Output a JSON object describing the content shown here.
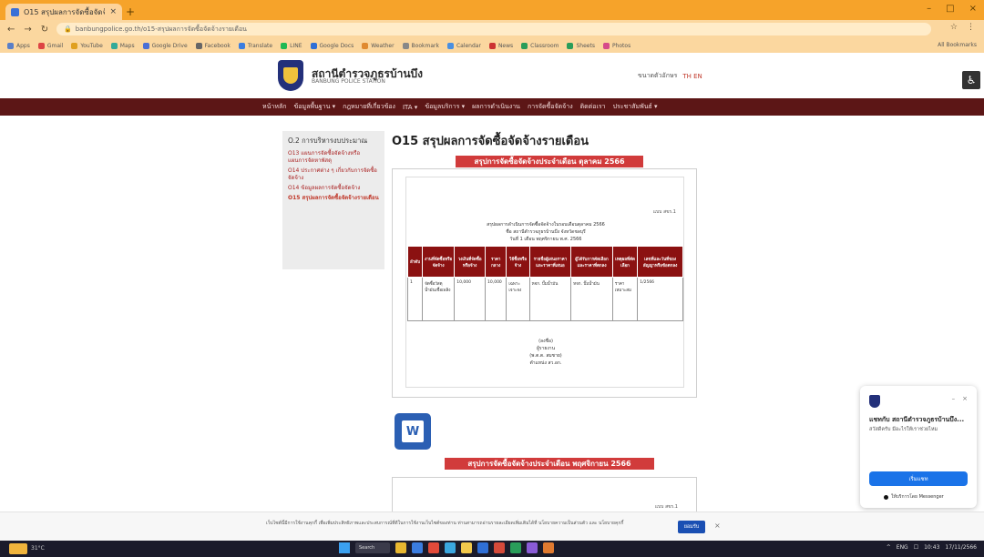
{
  "browser": {
    "tab_title": "O15 สรุปผลการจัดซื้อจัดจ้าง...",
    "tab_close": "×",
    "new_tab": "+",
    "window_controls": [
      "–",
      "□",
      "×"
    ],
    "nav": [
      "←",
      "→",
      "↻"
    ],
    "url": "banbungpolice.go.th/o15-สรุปผลการจัดซื้อจัดจ้างรายเดือน",
    "right_icons": [
      "☆",
      "⋮"
    ],
    "bookmarks": [
      "Apps",
      "Gmail",
      "YouTube",
      "Maps",
      "Google Drive",
      "Facebook",
      "Translate",
      "LINE",
      "Google Docs",
      "Weather",
      "Bookmark",
      "Calendar",
      "News",
      "Classroom",
      "Sheets",
      "Photos"
    ],
    "bookmarks_right": "All Bookmarks"
  },
  "site": {
    "name": "สถานีตำรวจภูธรบ้านบึง",
    "subtitle": "BANBUNG POLICE STATION",
    "header_right": "ขนาดตัวอักษร",
    "lang": "TH EN",
    "accessibility_icon": "♿"
  },
  "nav": {
    "items": [
      "หน้าหลัก",
      "ข้อมูลพื้นฐาน ▾",
      "กฎหมายที่เกี่ยวข้อง",
      "ITA ▾",
      "ข้อมูลบริการ ▾",
      "ผลการดำเนินงาน",
      "การจัดซื้อจัดจ้าง",
      "ติดต่อเรา",
      "ประชาสัมพันธ์ ▾"
    ]
  },
  "sidebar": {
    "title": "O.2 การบริหารงบประมาณ",
    "items": [
      "O13 แผนการจัดซื้อจัดจ้างหรือแผนการจัดหาพัสดุ",
      "O14 ประกาศต่าง ๆ เกี่ยวกับการจัดซื้อจัดจ้าง",
      "O14 ข้อมูลผลการจัดซื้อจัดจ้าง",
      "O15 สรุปผลการจัดซื้อจัดจ้างรายเดือน"
    ]
  },
  "main": {
    "title": "O15 สรุปผลการจัดซื้อจัดจ้างรายเดือน",
    "label1": "สรุปการจัดซื้อจัดจ้างประจำเดือน ตุลาคม 2566",
    "label2": "สรุปการจัดซื้อจัดจ้างประจำเดือน พฤศจิกายน 2566",
    "doc_page": "แบบ สขร.1",
    "doc_head1": "สรุปผลการดำเนินการจัดซื้อจัดจ้างในรอบเดือนตุลาคม 2566",
    "doc_head2": "ชื่อ สถานีตำรวจภูธรบ้านบึง จังหวัดชลบุรี",
    "doc_head3": "วันที่ 1 เดือน พฤศจิกายน พ.ศ. 2566",
    "doc2_page": "แบบ สขร.1",
    "headers": [
      "ลำดับ",
      "งานที่จัดซื้อหรือจัดจ้าง",
      "วงเงินที่จัดซื้อหรือจ้าง",
      "ราคากลาง",
      "วิธีซื้อหรือจ้าง",
      "รายชื่อผู้เสนอราคาและราคาที่เสนอ",
      "ผู้ได้รับการคัดเลือกและราคาที่ตกลง",
      "เหตุผลที่คัดเลือก",
      "เลขที่และวันที่ของสัญญาหรือข้อตกลง"
    ],
    "row": [
      "1",
      "จัดซื้อวัสดุน้ำมันเชื้อเพลิง",
      "10,000",
      "10,000",
      "เฉพาะเจาะจง",
      "หจก. ปั๊มน้ำมัน",
      "หจก. ปั๊มน้ำมัน",
      "ราคาเหมาะสม",
      "1/2566"
    ],
    "sig": [
      "(ลงชื่อ)",
      "ผู้รายงาน",
      "(พ.ต.ต. สมชาย)",
      "ตำแหน่ง สว.อก."
    ],
    "word_letter": "W"
  },
  "chat": {
    "name": "แชทกับ สถานีตำรวจภูธรบ้านบึง...",
    "message": "สวัสดีครับ มีอะไรให้เราช่วยไหม",
    "button": "เริ่มแชท",
    "footer": "ให้บริการโดย Messenger",
    "controls": [
      "–",
      "×"
    ]
  },
  "cookie": {
    "text": "เว็บไซต์นี้มีการใช้งานคุกกี้ เพื่อเพิ่มประสิทธิภาพและประสบการณ์ที่ดีในการใช้งานเว็บไซต์ของท่าน ท่านสามารถอ่านรายละเอียดเพิ่มเติมได้ที่ นโยบายความเป็นส่วนตัว และ นโยบายคุกกี้",
    "accept": "ยอมรับ",
    "close": "×"
  },
  "taskbar": {
    "weather": "31°C",
    "search": "Search",
    "tray": [
      "^",
      "ENG",
      "☐",
      "10:43",
      "17/11/2566"
    ]
  },
  "colors": {
    "tabstrip": "#f6a32a",
    "nav_bg": "#5c1616",
    "accent_red": "#d13b3b",
    "table_header": "#8b1111"
  }
}
